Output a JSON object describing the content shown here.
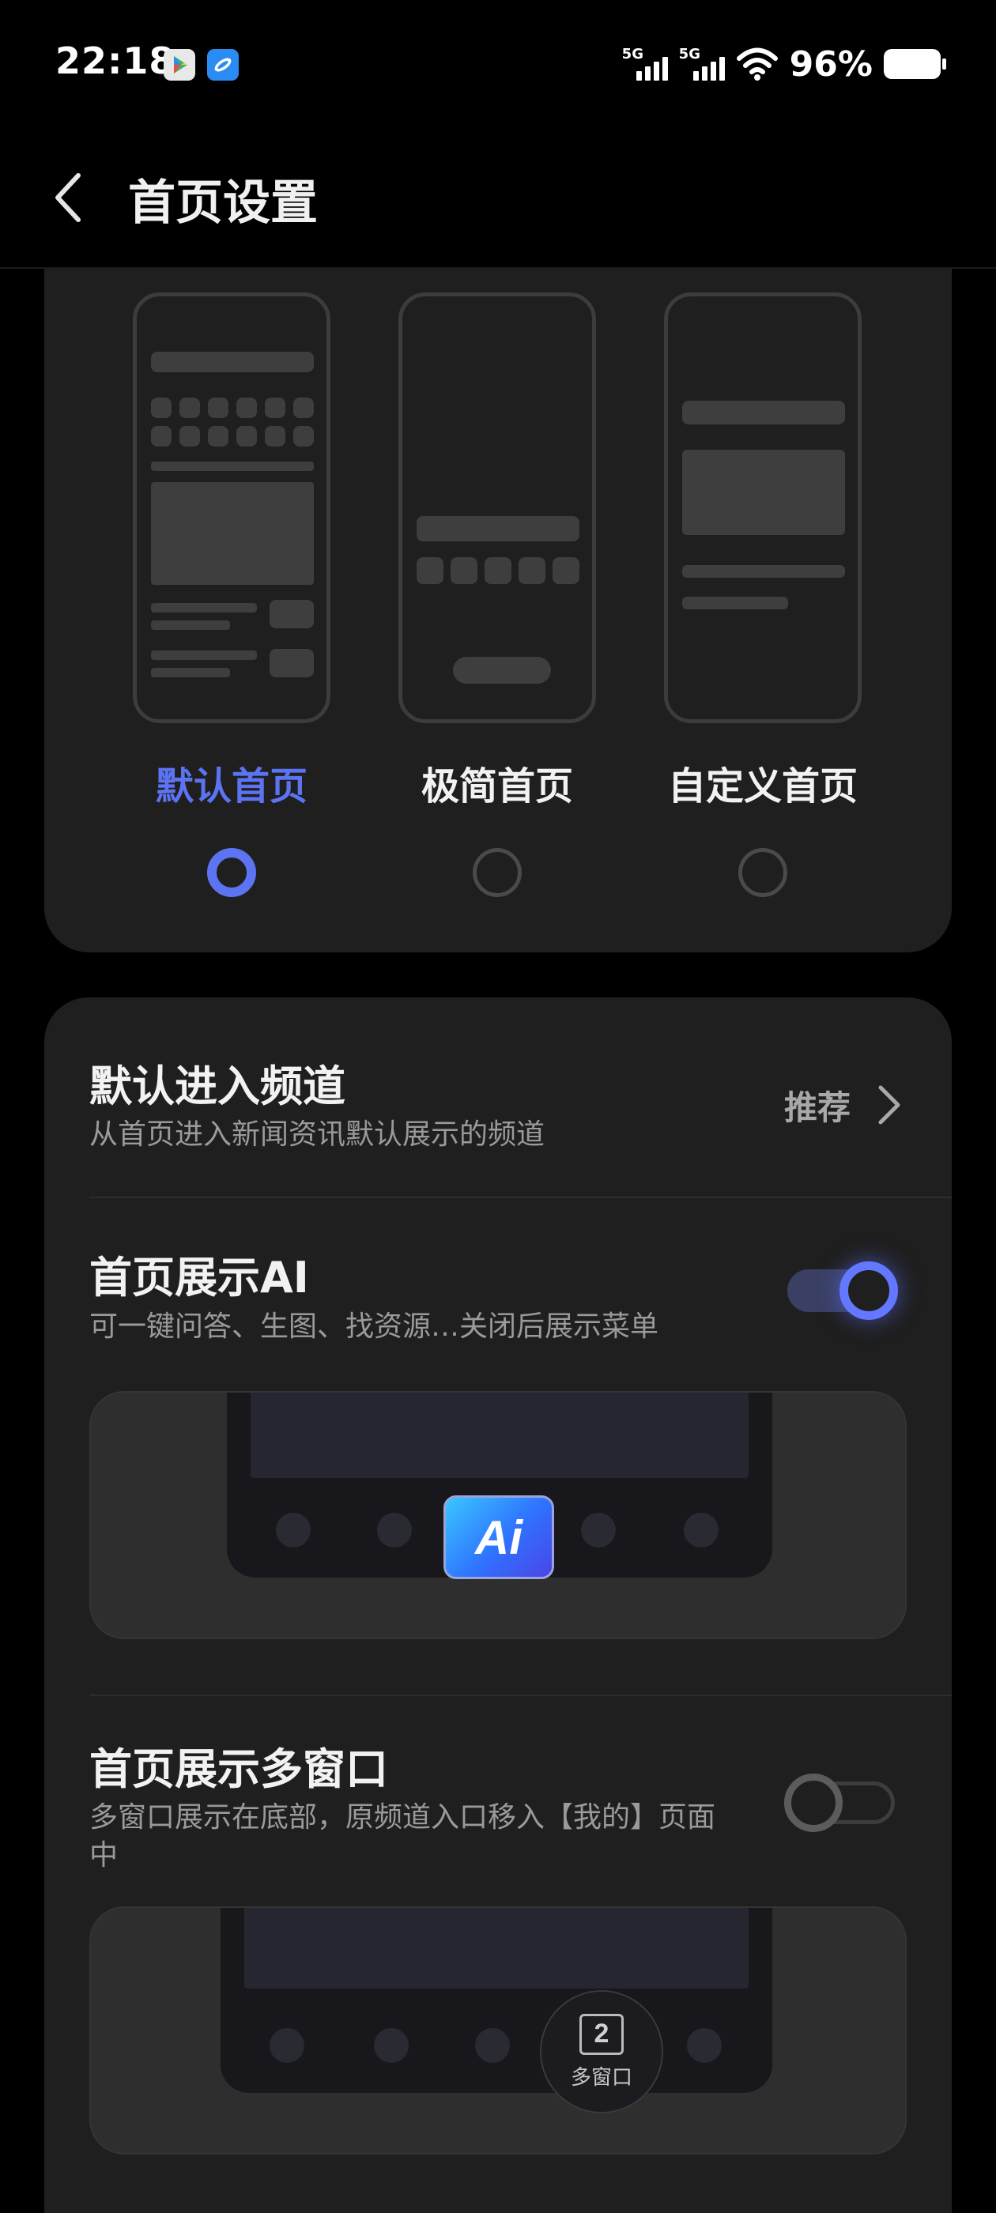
{
  "status_bar": {
    "time": "22:18",
    "icons": [
      "google-play-icon",
      "app-blue-icon"
    ],
    "signal_1": "5G",
    "signal_2": "5G",
    "battery": "96%"
  },
  "header": {
    "title": "首页设置",
    "back_icon": "chevron-left-icon"
  },
  "home_styles": {
    "options": [
      {
        "label": "默认首页",
        "selected": true
      },
      {
        "label": "极简首页",
        "selected": false
      },
      {
        "label": "自定义首页",
        "selected": false
      }
    ]
  },
  "settings": {
    "default_channel": {
      "title": "默认进入频道",
      "subtitle": "从首页进入新闻资讯默认展示的频道",
      "value": "推荐"
    },
    "show_ai": {
      "title": "首页展示AI",
      "subtitle": "可一键问答、生图、找资源…关闭后展示菜单",
      "enabled": true,
      "preview_badge": "Ai"
    },
    "show_multiwindow": {
      "title": "首页展示多窗口",
      "subtitle": "多窗口展示在底部，原频道入口移入【我的】页面中",
      "enabled": false,
      "preview_count": "2",
      "preview_label": "多窗口"
    }
  },
  "colors": {
    "accent": "#5c73f2",
    "toggle_on": "#6477ff",
    "card_bg": "#1f1f1f",
    "page_bg": "#000000"
  }
}
